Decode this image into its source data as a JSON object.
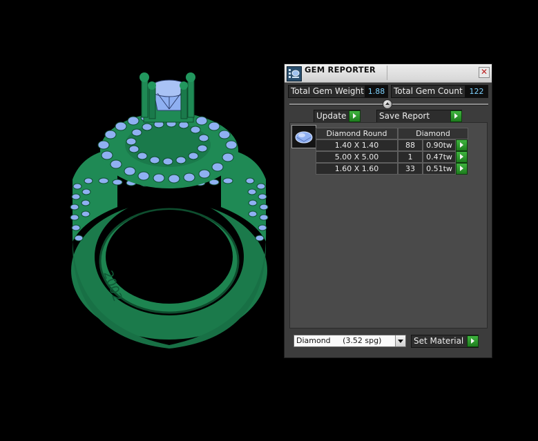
{
  "panel": {
    "title": "GEM REPORTER",
    "close_symbol": "✕",
    "stats": {
      "total_weight_label": "Total Gem Weight",
      "total_weight_value": "1.88",
      "total_count_label": "Total Gem Count",
      "total_count_value": "122"
    },
    "buttons": {
      "update": "Update",
      "save_report": "Save Report",
      "set_material": "Set Material"
    },
    "table": {
      "headers": [
        "Diamond Round",
        "Diamond"
      ],
      "rows": [
        {
          "size": "1.40 X 1.40",
          "count": "88",
          "weight": "0.90tw"
        },
        {
          "size": "5.00 X 5.00",
          "count": "1",
          "weight": "0.47tw"
        },
        {
          "size": "1.60 X 1.60",
          "count": "33",
          "weight": "0.51tw"
        }
      ]
    },
    "material_select": {
      "value": "Diamond     (3.52 spg)"
    }
  },
  "colors": {
    "background": "#000000",
    "metal": "#1f8a55",
    "gem": "#8fb0f2",
    "value_text": "#7fd3ff",
    "arrow_button": "#2f9d2f"
  },
  "icons": {
    "app": "gem-reporter-icon",
    "thumb": "round-diamond-icon",
    "close": "close-icon",
    "arrow": "play-arrow-icon",
    "dropdown": "chevron-down-icon"
  }
}
